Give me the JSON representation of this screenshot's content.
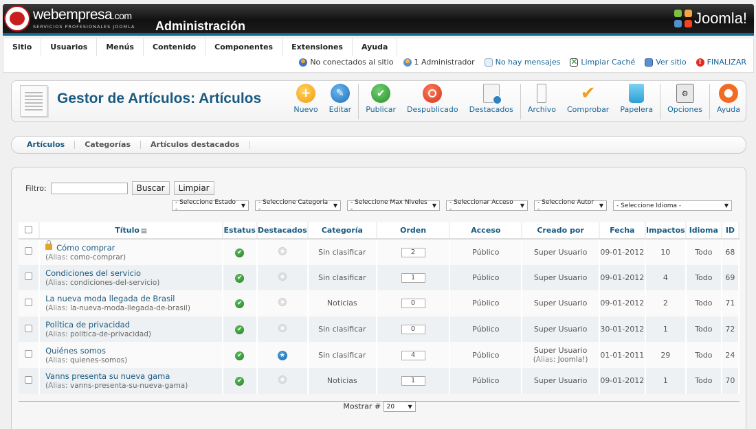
{
  "header": {
    "brand_name": "webempresa",
    "brand_domain": ".com",
    "brand_tagline": "SERVICIOS PROFESIONALES JOOMLA",
    "site_title": "Administración",
    "cms_name": "Joomla!"
  },
  "menu": [
    "Sitio",
    "Usuarios",
    "Menús",
    "Contenido",
    "Componentes",
    "Extensiones",
    "Ayuda"
  ],
  "status": {
    "no_connected": "No conectados al sitio",
    "admins": "1 Administrador",
    "messages": "No hay mensajes",
    "clear_cache": "Limpiar Caché",
    "view_site": "Ver sitio",
    "logout": "FINALIZAR"
  },
  "toolbar": {
    "title": "Gestor de Artículos: Artículos",
    "buttons": {
      "nuevo": "Nuevo",
      "editar": "Editar",
      "publicar": "Publicar",
      "despublicado": "Despublicado",
      "destacados": "Destacados",
      "archivo": "Archivo",
      "comprobar": "Comprobar",
      "papelera": "Papelera",
      "opciones": "Opciones",
      "ayuda": "Ayuda"
    }
  },
  "submenu": [
    "Artículos",
    "Categorías",
    "Artículos destacados"
  ],
  "filter": {
    "label": "Filtro:",
    "value": "",
    "search_btn": "Buscar",
    "clear_btn": "Limpiar",
    "selects": [
      "- Seleccione Estado -",
      "- Seleccione Categoría -",
      "- Seleccione Max Niveles -",
      "- Seleccionar Acceso -",
      "- Seleccione Autor -",
      "- Seleccione Idioma -"
    ]
  },
  "table": {
    "headers": [
      "Título",
      "Estatus",
      "Destacados",
      "Categoría",
      "Orden",
      "Acceso",
      "Creado por",
      "Fecha",
      "Impactos",
      "Idioma",
      "ID"
    ],
    "alias_label": "Alias",
    "rows": [
      {
        "title": "Cómo comprar",
        "alias": "como-comprar",
        "featured": false,
        "category": "Sin clasificar",
        "order": "2",
        "access": "Público",
        "author": "Super Usuario",
        "author_alias": "",
        "date": "09-01-2012",
        "hits": "10",
        "lang": "Todo",
        "id": "68"
      },
      {
        "title": "Condiciones del servicio",
        "alias": "condiciones-del-servicio",
        "featured": false,
        "category": "Sin clasificar",
        "order": "1",
        "access": "Público",
        "author": "Super Usuario",
        "author_alias": "",
        "date": "09-01-2012",
        "hits": "4",
        "lang": "Todo",
        "id": "69"
      },
      {
        "title": "La nueva moda llegada de Brasil",
        "alias": "la-nueva-moda-llegada-de-brasil",
        "featured": false,
        "category": "Noticias",
        "order": "0",
        "access": "Público",
        "author": "Super Usuario",
        "author_alias": "",
        "date": "09-01-2012",
        "hits": "2",
        "lang": "Todo",
        "id": "71"
      },
      {
        "title": "Política de privacidad",
        "alias": "politica-de-privacidad",
        "featured": false,
        "category": "Sin clasificar",
        "order": "0",
        "access": "Público",
        "author": "Super Usuario",
        "author_alias": "",
        "date": "30-01-2012",
        "hits": "1",
        "lang": "Todo",
        "id": "72"
      },
      {
        "title": "Quiénes somos",
        "alias": "quienes-somos",
        "featured": true,
        "category": "Sin clasificar",
        "order": "4",
        "access": "Público",
        "author": "Super Usuario",
        "author_alias": "Joomla!",
        "date": "01-01-2011",
        "hits": "29",
        "lang": "Todo",
        "id": "24"
      },
      {
        "title": "Vanns presenta su nueva gama",
        "alias": "vanns-presenta-su-nueva-gama",
        "featured": false,
        "category": "Noticias",
        "order": "1",
        "access": "Público",
        "author": "Super Usuario",
        "author_alias": "",
        "date": "09-01-2012",
        "hits": "1",
        "lang": "Todo",
        "id": "70"
      }
    ]
  },
  "pagination": {
    "label": "Mostrar #",
    "value": "20"
  }
}
